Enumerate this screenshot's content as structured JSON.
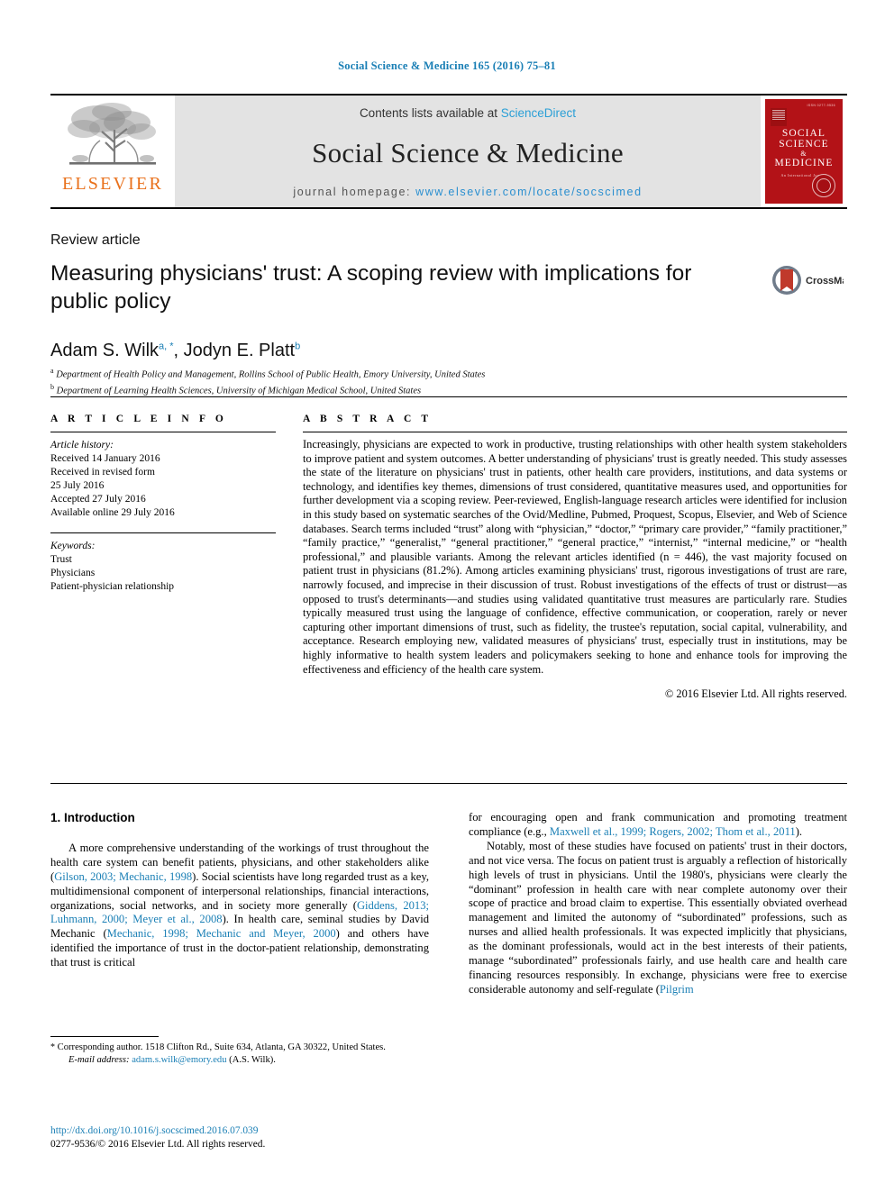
{
  "running_head": "Social Science & Medicine 165 (2016) 75–81",
  "masthead": {
    "contents_prefix": "Contents lists available at ",
    "sciencedirect": "ScienceDirect",
    "journal_name": "Social Science & Medicine",
    "homepage_label": "journal homepage: ",
    "homepage_url": "www.elsevier.com/locate/socscimed",
    "publisher": "ELSEVIER",
    "cover": {
      "line1": "SOCIAL",
      "line2": "SCIENCE",
      "amp": "&",
      "line3": "MEDICINE",
      "top_note": "ISSN 0277-9536",
      "subtitle": "An International Journal"
    }
  },
  "article": {
    "type": "Review article",
    "title": "Measuring physicians' trust: A scoping review with implications for public policy",
    "crossmark_label": "CrossMark",
    "authors": "Adam S. Wilk, Jodyn E. Platt",
    "author_1": "Adam S. Wilk",
    "author_1_marks": "a, *",
    "author_2": "Jodyn E. Platt",
    "author_2_marks": "b",
    "affiliation_a": "Department of Health Policy and Management, Rollins School of Public Health, Emory University, United States",
    "affiliation_b": "Department of Learning Health Sciences, University of Michigan Medical School, United States"
  },
  "info": {
    "heading": "A R T I C L E   I N F O",
    "history_label": "Article history:",
    "history": [
      "Received 14 January 2016",
      "Received in revised form",
      "25 July 2016",
      "Accepted 27 July 2016",
      "Available online 29 July 2016"
    ],
    "keywords_label": "Keywords:",
    "keywords": [
      "Trust",
      "Physicians",
      "Patient-physician relationship"
    ]
  },
  "abstract": {
    "heading": "A B S T R A C T",
    "text": "Increasingly, physicians are expected to work in productive, trusting relationships with other health system stakeholders to improve patient and system outcomes. A better understanding of physicians' trust is greatly needed. This study assesses the state of the literature on physicians' trust in patients, other health care providers, institutions, and data systems or technology, and identifies key themes, dimensions of trust considered, quantitative measures used, and opportunities for further development via a scoping review. Peer-reviewed, English-language research articles were identified for inclusion in this study based on systematic searches of the Ovid/Medline, Pubmed, Proquest, Scopus, Elsevier, and Web of Science databases. Search terms included “trust” along with “physician,” “doctor,” “primary care provider,” “family practitioner,” “family practice,” “generalist,” “general practitioner,” “general practice,” “internist,” “internal medicine,” or “health professional,” and plausible variants. Among the relevant articles identified (n = 446), the vast majority focused on patient trust in physicians (81.2%). Among articles examining physicians' trust, rigorous investigations of trust are rare, narrowly focused, and imprecise in their discussion of trust. Robust investigations of the effects of trust or distrust—as opposed to trust's determinants—and studies using validated quantitative trust measures are particularly rare. Studies typically measured trust using the language of confidence, effective communication, or cooperation, rarely or never capturing other important dimensions of trust, such as fidelity, the trustee's reputation, social capital, vulnerability, and acceptance. Research employing new, validated measures of physicians' trust, especially trust in institutions, may be highly informative to health system leaders and policymakers seeking to hone and enhance tools for improving the effectiveness and efficiency of the health care system.",
    "copyright": "© 2016 Elsevier Ltd. All rights reserved."
  },
  "body": {
    "section_number_title": "1. Introduction",
    "left_para_1_part1": "A more comprehensive understanding of the workings of trust throughout the health care system can benefit patients, physicians, and other stakeholders alike (",
    "left_cite_1": "Gilson, 2003; Mechanic, 1998",
    "left_para_1_part2": "). Social scientists have long regarded trust as a key, multidimensional component of interpersonal relationships, financial interactions, organizations, social networks, and in society more generally (",
    "left_cite_2": "Giddens, 2013; Luhmann, 2000; Meyer et al., 2008",
    "left_para_1_part3": "). In health care, seminal studies by David Mechanic (",
    "left_cite_3": "Mechanic, 1998; Mechanic and Meyer, 2000",
    "left_para_1_part4": ") and others have identified the importance of trust in the doctor-patient relationship, demonstrating that trust is critical",
    "right_para_1_part1": "for encouraging open and frank communication and promoting treatment compliance (e.g., ",
    "right_cite_1": "Maxwell et al., 1999; Rogers, 2002; Thom et al., 2011",
    "right_para_1_part2": ").",
    "right_para_2_part1": "Notably, most of these studies have focused on patients' trust in their doctors, and not vice versa. The focus on patient trust is arguably a reflection of historically high levels of trust in physicians. Until the 1980's, physicians were clearly the “dominant” profession in health care with near complete autonomy over their scope of practice and broad claim to expertise. This essentially obviated overhead management and limited the autonomy of “subordinated” professions, such as nurses and allied health professionals. It was expected implicitly that physicians, as the dominant professionals, would act in the best interests of their patients, manage “subordinated” professionals fairly, and use health care and health care financing resources responsibly. In exchange, physicians were free to exercise considerable autonomy and self-regulate (",
    "right_cite_2": "Pilgrim"
  },
  "footnote": {
    "star": "*",
    "corresponding": "Corresponding author. 1518 Clifton Rd., Suite 634, Atlanta, GA 30322, United States.",
    "email_label": "E-mail address:",
    "email": "adam.s.wilk@emory.edu",
    "email_suffix": "(A.S. Wilk).",
    "doi": "http://dx.doi.org/10.1016/j.socscimed.2016.07.039",
    "issn_line": "0277-9536/© 2016 Elsevier Ltd. All rights reserved."
  },
  "colors": {
    "link": "#1a7fb5",
    "elsevier_orange": "#E9711C",
    "cover_red": "#b31217",
    "masthead_gray": "#e3e3e3"
  }
}
